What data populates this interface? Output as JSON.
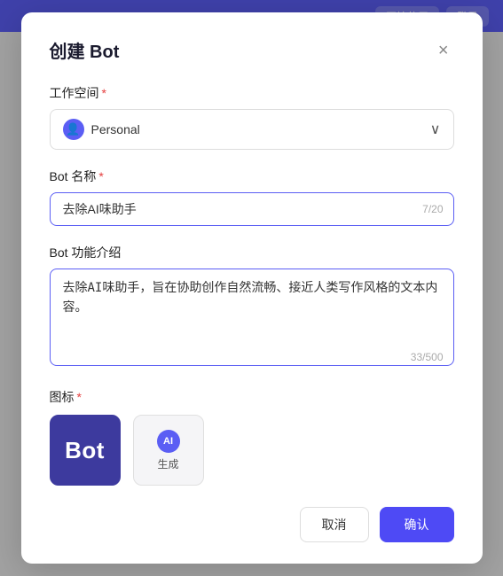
{
  "topbar": {
    "btn1": "开始使用",
    "btn2": "登录"
  },
  "modal": {
    "title": "创建 Bot",
    "close_label": "×",
    "workspace_label": "工作空间",
    "workspace_required": "*",
    "workspace_value": "Personal",
    "bot_name_label": "Bot 名称",
    "bot_name_required": "*",
    "bot_name_value": "去除AI味助手",
    "bot_name_char_count": "7/20",
    "bot_desc_label": "Bot 功能介绍",
    "bot_desc_value": "去除AI味助手，旨在协助创作自然流畅、接近人类写作风格的文本内容。",
    "bot_desc_char_count": "33/500",
    "icon_label": "图标",
    "icon_required": "*",
    "bot_icon_text": "Bot",
    "generate_label": "生成",
    "ai_badge": "AI",
    "cancel_label": "取消",
    "confirm_label": "确认"
  }
}
